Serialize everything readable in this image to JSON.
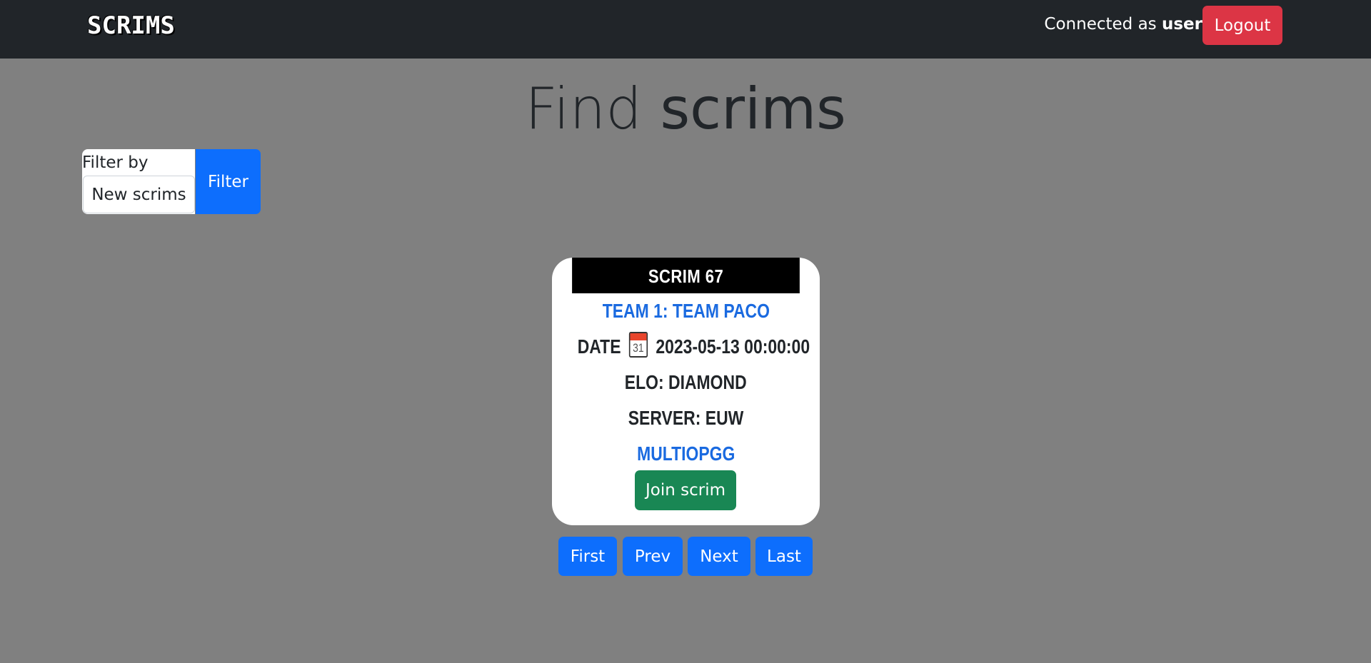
{
  "navbar": {
    "logo_text": "SCRIMS",
    "connected_prefix": "Connected as",
    "username": "user",
    "logout_label": "Logout"
  },
  "title": {
    "light": "Find",
    "strong": "scrims"
  },
  "filter": {
    "label": "Filter by",
    "selected": "New scrims",
    "button_label": "Filter"
  },
  "scrim": {
    "header": "SCRIM 67",
    "team": "TEAM 1: TEAM PACO",
    "date_label": "DATE",
    "calendar_icon": "calendar-icon",
    "calendar_day": "31",
    "date_value": "2023-05-13 00:00:00",
    "elo": "ELO: DIAMOND",
    "server": "SERVER: EUW",
    "link_label": "MULTIOPGG",
    "join_label": "Join scrim"
  },
  "pagination": {
    "first": "First",
    "prev": "Prev",
    "next": "Next",
    "last": "Last"
  },
  "colors": {
    "navbar_bg": "#212529",
    "page_bg": "#808080",
    "primary": "#0d6efd",
    "danger": "#dc3545",
    "success": "#198754",
    "link": "#1a6ae0"
  }
}
